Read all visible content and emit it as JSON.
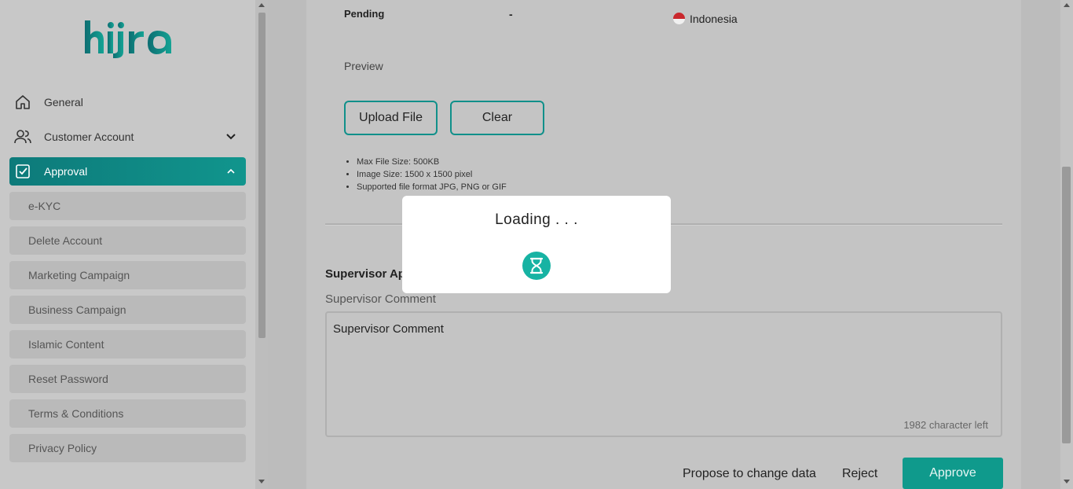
{
  "brand": {
    "logo_text": "hijra",
    "accent": "#10908a"
  },
  "sidebar": {
    "items": [
      {
        "label": "General",
        "icon": "home-icon"
      },
      {
        "label": "Customer Account",
        "icon": "users-icon"
      },
      {
        "label": "Approval",
        "icon": "checkbox-icon"
      }
    ],
    "sub_items": [
      "e-KYC",
      "Delete Account",
      "Marketing Campaign",
      "Business Campaign",
      "Islamic Content",
      "Reset Password",
      "Terms & Conditions",
      "Privacy Policy"
    ]
  },
  "main": {
    "status_label": "Pending",
    "dash": "-",
    "country": "Indonesia",
    "preview_label": "Preview",
    "upload_label": "Upload File",
    "clear_label": "Clear",
    "notes": [
      "Max File Size: 500KB",
      "Image Size: 1500 x 1500 pixel",
      "Supported file format JPG, PNG or GIF"
    ],
    "section_title": "Supervisor Approval",
    "comment_label": "Supervisor Comment",
    "comment_placeholder": "Supervisor Comment",
    "char_left": "1982 character left",
    "propose_label": "Propose to change data",
    "reject_label": "Reject",
    "approve_label": "Approve"
  },
  "modal": {
    "title": "Loading . . ."
  }
}
